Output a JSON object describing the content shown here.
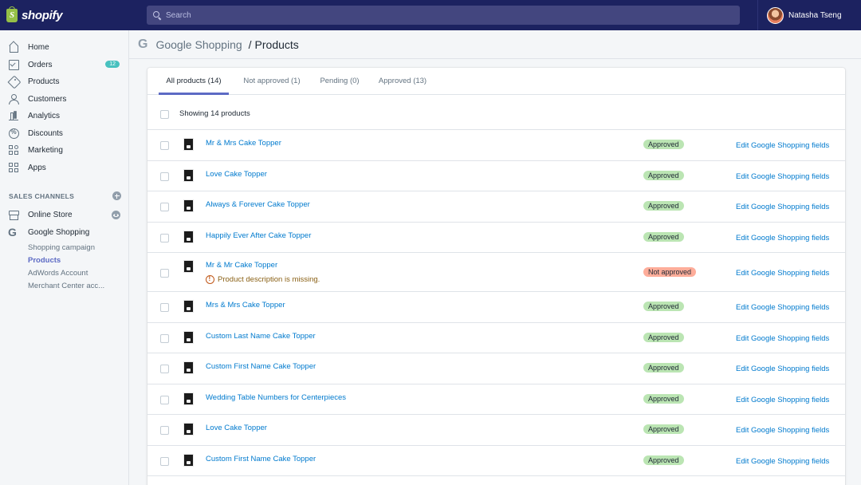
{
  "app": {
    "brand": "shopify"
  },
  "search": {
    "placeholder": "Search"
  },
  "user": {
    "name": "Natasha Tseng"
  },
  "sidebar": {
    "items": [
      {
        "label": "Home",
        "icon": "home-icon"
      },
      {
        "label": "Orders",
        "icon": "orders-icon",
        "badge": "12"
      },
      {
        "label": "Products",
        "icon": "tag-icon"
      },
      {
        "label": "Customers",
        "icon": "person-icon"
      },
      {
        "label": "Analytics",
        "icon": "bar-chart-icon"
      },
      {
        "label": "Discounts",
        "icon": "discount-icon"
      },
      {
        "label": "Marketing",
        "icon": "grid-icon"
      },
      {
        "label": "Apps",
        "icon": "grid-icon"
      }
    ],
    "sales_channels_title": "SALES CHANNELS",
    "channels": [
      {
        "label": "Online Store",
        "icon": "store-icon"
      },
      {
        "label": "Google Shopping",
        "icon": "google-icon"
      }
    ],
    "sub_items": [
      {
        "label": "Shopping campaign"
      },
      {
        "label": "Products"
      },
      {
        "label": "AdWords Account"
      },
      {
        "label": "Merchant Center acc..."
      }
    ]
  },
  "header": {
    "breadcrumb": "Google Shopping",
    "separator": "/",
    "title": "Products"
  },
  "tabs": [
    {
      "label": "All products (14)"
    },
    {
      "label": "Not approved (1)"
    },
    {
      "label": "Pending (0)"
    },
    {
      "label": "Approved (13)"
    }
  ],
  "list": {
    "showing_text": "Showing 14 products",
    "edit_label": "Edit Google Shopping fields",
    "rows": [
      {
        "name": "Mr & Mrs Cake Topper",
        "status": "Approved"
      },
      {
        "name": "Love Cake Topper",
        "status": "Approved"
      },
      {
        "name": "Always & Forever Cake Topper",
        "status": "Approved"
      },
      {
        "name": "Happily Ever After Cake Topper",
        "status": "Approved"
      },
      {
        "name": "Mr & Mr Cake Topper",
        "status": "Not approved",
        "warning": "Product description is missing."
      },
      {
        "name": "Mrs & Mrs Cake Topper",
        "status": "Approved"
      },
      {
        "name": "Custom Last Name Cake Topper",
        "status": "Approved"
      },
      {
        "name": "Custom First Name Cake Topper",
        "status": "Approved"
      },
      {
        "name": "Wedding Table Numbers for Centerpieces",
        "status": "Approved"
      },
      {
        "name": "Love Cake Topper",
        "status": "Approved"
      },
      {
        "name": "Custom First Name Cake Topper",
        "status": "Approved"
      }
    ]
  },
  "colors": {
    "topbar": "#1c2260",
    "accent": "#5c6ac4",
    "link": "#007ace",
    "approved": "#bbe5b3",
    "not_approved": "#fead9a",
    "badge": "#47c1bf"
  }
}
